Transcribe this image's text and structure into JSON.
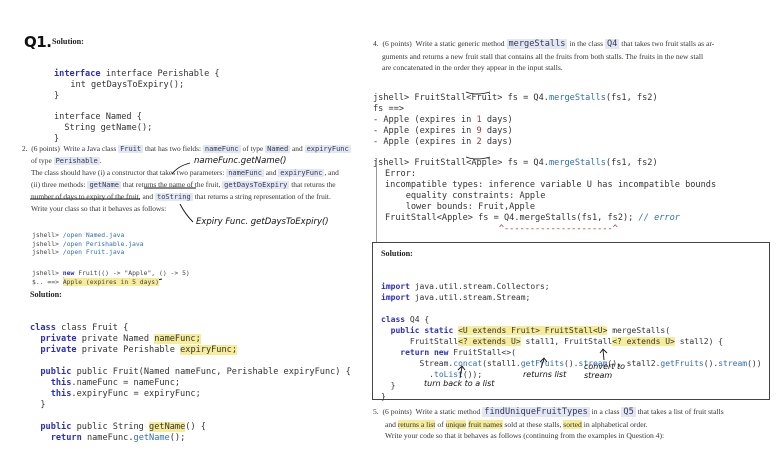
{
  "left": {
    "q1_mark": "Q1.",
    "solution_label": "Solution:",
    "iface1": [
      "interface Perishable {",
      "  int getDaysToExpiry();",
      "}"
    ],
    "iface2": [
      "interface Named {",
      "  String getName();",
      "}"
    ],
    "q2": {
      "num": "2.",
      "points": "(6 points)",
      "line1_a": "Write a Java class",
      "cls": "Fruit",
      "line1_b": "that has two fields:",
      "f1": "nameFunc",
      "line1_c": "of type",
      "t1": "Named",
      "line1_d": "and",
      "f2": "expiryFunc",
      "line2_a": "of type",
      "t2": "Perishable",
      "line2_b": ".",
      "line3": "The class should have (i) a constructor that takes two parameters:",
      "p1": "nameFunc",
      "line3_and": "and",
      "p2": "expiryFunc",
      "line3_end": ", and",
      "line4_a": "(ii) three methods:",
      "m1": "getName",
      "line4_b": "that returns the name of the fruit,",
      "m2": "getDaysToExpiry",
      "line4_c": "that returns the",
      "line5_a": "number of days to expiry of the fruit, and",
      "m3": "toString",
      "line5_b": "that returns a string representation of the fruit.",
      "line6": "Write your class so that it behaves as follows:"
    },
    "jshell_open": [
      {
        "prompt": "jshell>",
        "cmd": "/open Named.java"
      },
      {
        "prompt": "jshell>",
        "cmd": "/open Perishable.java"
      },
      {
        "prompt": "jshell>",
        "cmd": "/open Fruit.java"
      }
    ],
    "jshell_new": {
      "prompt": "jshell>",
      "kw_new": "new",
      "rest": "Fruit(() -> \"Apple\", () -> 5)",
      "res_prefix": "$..",
      "arrow": "==>",
      "res_value": "Apple (expires in 5 days)"
    },
    "handwriting": {
      "note1": "nameFunc.getName()",
      "note2": "Expiry Func. getDaysToExpiry()"
    },
    "solution2_label": "Solution:",
    "fruit_code": {
      "l1": "class Fruit {",
      "l2a": "private Named",
      "l2b": "nameFunc;",
      "l3a": "private Perishable",
      "l3b": "expiryFunc;",
      "l4": "public Fruit(Named nameFunc, Perishable expiryFunc) {",
      "l5a": "this",
      "l5b": ".nameFunc = nameFunc;",
      "l6a": "this",
      "l6b": ".expiryFunc = expiryFunc;",
      "l7": "}",
      "l8a": "public String",
      "l8b": "getName",
      "l8c": "() {",
      "l9a": "return",
      "l9b": "nameFunc.",
      "l9c": "getName",
      "l9d": "();"
    }
  },
  "right": {
    "q4": {
      "num": "4.",
      "points": "(6 points)",
      "l1a": "Write a static generic method",
      "method": "mergeStalls",
      "l1b": "in the class",
      "cls": "Q4",
      "l1c": "that takes two fruit stalls as ar-",
      "l2": "guments and returns a new fruit stall that contains all the fruits from both stalls. The fruits in the new stall",
      "l3": "are concatenated in the order they appear in the input stalls."
    },
    "shell1": {
      "prompt": "jshell>",
      "type": "FruitStall<Fruit>",
      "rest_a": "fs = Q4.",
      "call": "mergeStalls",
      "rest_b": "(fs1, fs2)",
      "fs_line": "fs ==>",
      "items": [
        {
          "a": "- Apple (expires in ",
          "n": "1",
          "b": " days)"
        },
        {
          "a": "- Apple (expires in ",
          "n": "9",
          "b": " days)"
        },
        {
          "a": "- Apple (expires in ",
          "n": "2",
          "b": " days)"
        }
      ]
    },
    "shell2": {
      "prompt": "jshell>",
      "type": "FruitStall<Apple>",
      "rest_a": "fs = Q4.",
      "call": "mergeStalls",
      "rest_b": "(fs1, fs2)",
      "err": [
        "Error:",
        "incompatible types: inference variable U has incompatible bounds",
        "    equality constraints: Apple",
        "    lower bounds: Fruit,Apple",
        "FruitStall<Apple> fs = Q4.mergeStalls(fs1, fs2);",
        "                      ^---------------------^"
      ],
      "err_comment": "// error"
    },
    "sol_box": {
      "label": "Solution:",
      "imp1_kw": "import",
      "imp1": "java.util.stream.Collectors;",
      "imp2_kw": "import",
      "imp2": "java.util.stream.Stream;",
      "c1_kw": "class",
      "c1": "Q4 {",
      "c2_kw": "public static",
      "c2_hl": "<U extends Fruit> FruitStall<U>",
      "c2_rest": "mergeStalls(",
      "c3a": "FruitStall",
      "c3_hl1": "<? extends U>",
      "c3b": "stall1, FruitStall",
      "c3_hl2": "<? extends U>",
      "c3c": "stall2) {",
      "c4_kw": "return new",
      "c4": "FruitStall<>(",
      "c5a": "Stream.",
      "c5b": "concat",
      "c5c": "(stall1.",
      "c5d": "getFruits",
      "c5e": "().",
      "c5f": "stream",
      "c5g": "(), stall2.",
      "c5h": "getFruits",
      "c5i": "().",
      "c5j": "stream",
      "c5k": "())",
      "c6a": ".",
      "c6b": "toList",
      "c6c": "());",
      "c7": "}",
      "c8": "}",
      "hand1": "turn back to a list",
      "hand2": "returns list",
      "hand3": "convert to stream"
    },
    "q5": {
      "num": "5.",
      "points": "(6 points)",
      "l1a": "Write a static method",
      "method": "findUniqueFruitTypes",
      "l1b": "in a class",
      "cls": "Q5",
      "l1c": "that takes a list of fruit stalls",
      "l2a": "and",
      "l2b": "returns a list",
      "l2c": "of",
      "l2d": "unique",
      "l2e": "fruit names",
      "l2f": "sold at these stalls,",
      "l2g": "sorted",
      "l2h": "in alphabetical order.",
      "l3": "Write your code so that it behaves as follows (continuing from the examples in Question 4):"
    }
  }
}
